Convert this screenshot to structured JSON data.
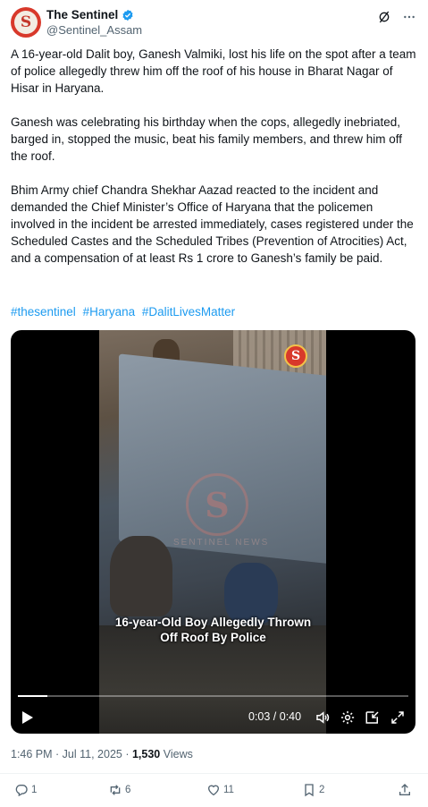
{
  "account": {
    "display_name": "The Sentinel",
    "handle": "@Sentinel_Assam",
    "avatar_letter": "S"
  },
  "tweet": {
    "paragraphs": [
      "A 16-year-old Dalit boy, Ganesh Valmiki, lost his life on the spot after a team of police allegedly threw him off the roof of his house in Bharat Nagar of Hisar in Haryana.",
      "Ganesh was celebrating his birthday when the cops, allegedly inebriated, barged in, stopped the music, beat his family members, and threw him off the roof.",
      "Bhim Army chief Chandra Shekhar Aazad reacted to the incident and demanded the Chief Minister’s Office of Haryana that the policemen involved in the incident be arrested immediately, cases registered under the Scheduled Castes and the Scheduled Tribes (Prevention of Atrocities) Act, and a compensation of at least Rs 1 crore to Ganesh’s family be paid."
    ],
    "hashtags": [
      "#thesentinel",
      "#Haryana",
      "#DalitLivesMatter"
    ]
  },
  "video": {
    "caption_line1": "16-year-Old Boy Allegedly Thrown",
    "caption_line2": "Off Roof By Police",
    "time_display": "0:03 / 0:40",
    "progress": 0.075,
    "logo_letter": "S",
    "watermark_letter": "S",
    "watermark_text": "SENTINEL NEWS"
  },
  "meta": {
    "time": "1:46 PM",
    "separator": " · ",
    "date": "Jul 11, 2025",
    "views_count": "1,530",
    "views_label": "Views"
  },
  "actions": {
    "replies": "1",
    "reposts": "6",
    "likes": "11",
    "bookmarks": "2"
  },
  "colors": {
    "link": "#1d9bf0",
    "verified": "#1d9bf0",
    "brand": "#d8392b",
    "muted": "#536471"
  },
  "icons": [
    "verified-badge-icon",
    "grok-icon",
    "more-icon",
    "play-icon",
    "volume-icon",
    "settings-icon",
    "pip-icon",
    "fullscreen-icon",
    "reply-icon",
    "repost-icon",
    "like-icon",
    "bookmark-icon",
    "share-icon"
  ]
}
